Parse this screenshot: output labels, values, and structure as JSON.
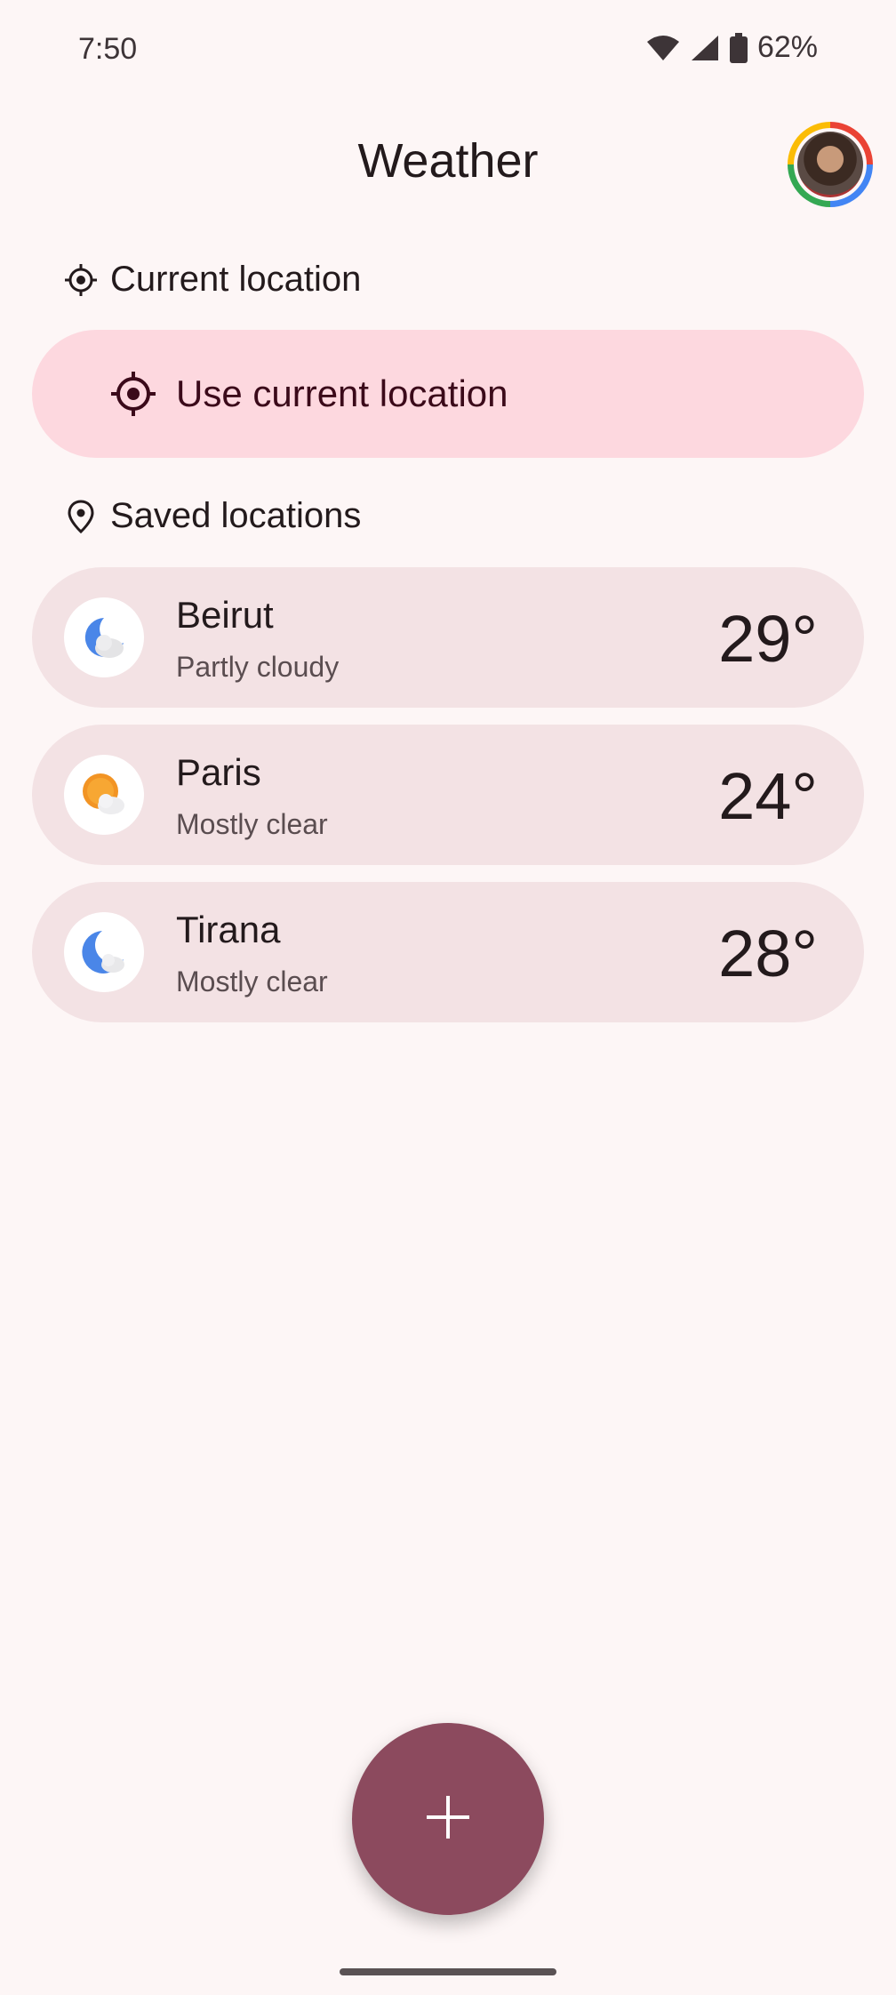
{
  "status_bar": {
    "time": "7:50",
    "battery": "62%",
    "icons": [
      "wifi-icon",
      "signal-icon",
      "battery-icon"
    ]
  },
  "header": {
    "title": "Weather",
    "avatar": "account-avatar"
  },
  "current_location": {
    "heading": "Current location",
    "heading_icon": "crosshair-icon",
    "button_label": "Use current location",
    "button_icon": "my-location-icon"
  },
  "saved_locations": {
    "heading": "Saved locations",
    "heading_icon": "pin-icon",
    "items": [
      {
        "name": "Beirut",
        "condition": "Partly cloudy",
        "temp": "29°",
        "icon": "night-partly-cloudy-icon"
      },
      {
        "name": "Paris",
        "condition": "Mostly clear",
        "temp": "24°",
        "icon": "sun-cloud-icon"
      },
      {
        "name": "Tirana",
        "condition": "Mostly clear",
        "temp": "28°",
        "icon": "moon-cloud-icon"
      }
    ]
  },
  "fab": {
    "icon": "plus-icon"
  },
  "colors": {
    "background": "#fdf6f6",
    "accent_pill": "#fdd8df",
    "card": "#f3e2e4",
    "fab": "#8c4a5e"
  }
}
